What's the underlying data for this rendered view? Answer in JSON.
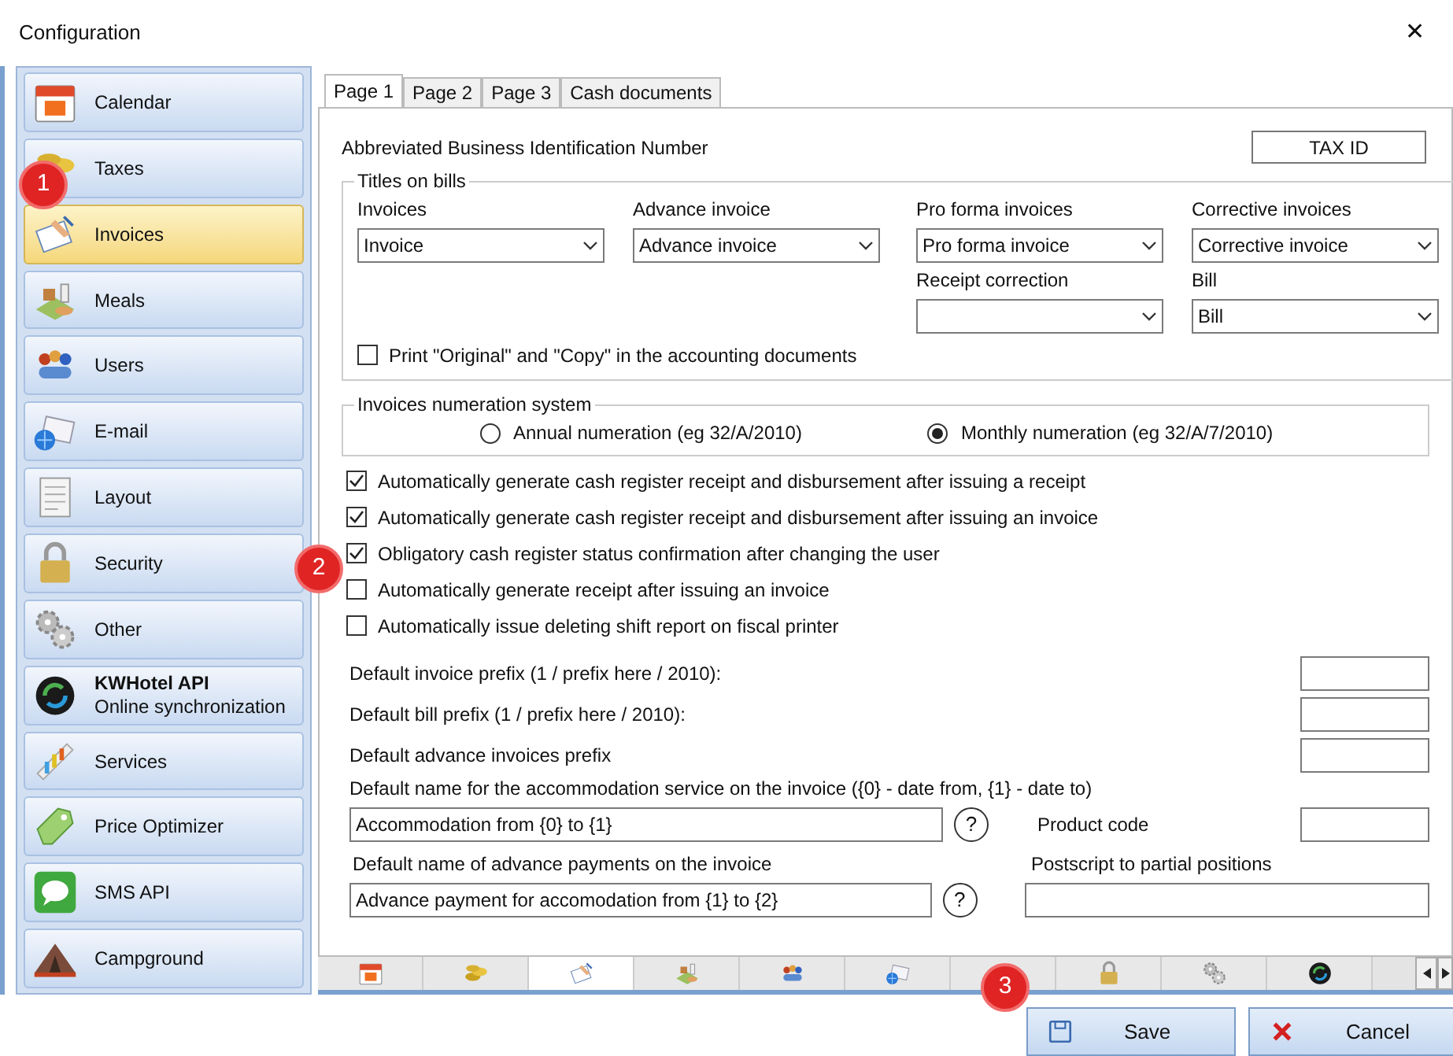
{
  "window": {
    "title": "Configuration",
    "close": "✕"
  },
  "sidebar": {
    "items": [
      {
        "label": "Calendar",
        "kind": "calendar",
        "selected": false
      },
      {
        "label": "Taxes",
        "kind": "coins",
        "selected": false
      },
      {
        "label": "Invoices",
        "kind": "invoice",
        "selected": true
      },
      {
        "label": "Meals",
        "kind": "meals",
        "selected": false
      },
      {
        "label": "Users",
        "kind": "users",
        "selected": false
      },
      {
        "label": "E-mail",
        "kind": "email",
        "selected": false
      },
      {
        "label": "Layout",
        "kind": "layout",
        "selected": false
      },
      {
        "label": "Security",
        "kind": "lock",
        "selected": false
      },
      {
        "label": "Other",
        "kind": "gears",
        "selected": false
      },
      {
        "label": "KWHotel API",
        "subtitle": "Online synchronization",
        "kind": "sync",
        "selected": false
      },
      {
        "label": "Services",
        "kind": "chart",
        "selected": false
      },
      {
        "label": "Price Optimizer",
        "kind": "tag",
        "selected": false
      },
      {
        "label": "SMS API",
        "kind": "sms",
        "selected": false
      },
      {
        "label": "Campground",
        "kind": "tent",
        "selected": false
      }
    ]
  },
  "tabs": [
    {
      "label": "Page 1",
      "selected": true
    },
    {
      "label": "Page 2",
      "selected": false
    },
    {
      "label": "Page 3",
      "selected": false
    },
    {
      "label": "Cash documents",
      "selected": false
    }
  ],
  "tax_id_row": {
    "label": "Abbreviated Business Identification Number",
    "button": "TAX ID"
  },
  "titles_on_bills": {
    "title": "Titles on bills",
    "fields": [
      {
        "label": "Invoices",
        "value": "Invoice"
      },
      {
        "label": "Advance invoice",
        "value": "Advance invoice"
      },
      {
        "label": "Pro forma invoices",
        "value": "Pro forma invoice"
      },
      {
        "label": "Corrective invoices",
        "value": "Corrective invoice"
      },
      {
        "label": "Receipt correction"
      },
      {
        "label": "Bill",
        "value": "Bill"
      }
    ],
    "print_checkbox": {
      "label": "Print \"Original\" and \"Copy\" in the accounting documents",
      "checked": false
    }
  },
  "numeration": {
    "title": "Invoices numeration system",
    "options": [
      {
        "label": "Annual numeration (eg 32/A/2010)",
        "selected": false
      },
      {
        "label": "Monthly numeration (eg 32/A/7/2010)",
        "selected": true
      }
    ]
  },
  "options": [
    {
      "label": "Automatically generate cash register receipt and disbursement after issuing a receipt",
      "checked": true
    },
    {
      "label": "Automatically generate cash register receipt and disbursement after issuing an invoice",
      "checked": true
    },
    {
      "label": "Obligatory cash register status confirmation after changing the user",
      "checked": true
    },
    {
      "label": "Automatically generate receipt after issuing an invoice",
      "checked": false
    },
    {
      "label": "Automatically issue deleting shift report on fiscal printer",
      "checked": false
    }
  ],
  "prefixes": [
    {
      "label": "Default invoice prefix (1 / prefix here / 2010):"
    },
    {
      "label": "Default bill prefix (1 /  prefix here / 2010):"
    },
    {
      "label": "Default advance invoices prefix"
    }
  ],
  "accommodation_name": {
    "label": "Default name for the accommodation service on the invoice ({0} - date from, {1} - date to)",
    "value": "Accommodation from {0} to {1}",
    "help": "?"
  },
  "product_code": {
    "label": "Product code"
  },
  "advance_name": {
    "label": "Default name of advance payments on the invoice",
    "value": "Advance payment for accomodation from {1} to {2}",
    "help": "?"
  },
  "postscript": {
    "label": "Postscript to partial positions"
  },
  "icon_tabs": [
    {
      "kind": "calendar",
      "selected": false
    },
    {
      "kind": "coins",
      "selected": false
    },
    {
      "kind": "invoice",
      "selected": true
    },
    {
      "kind": "meals",
      "selected": false
    },
    {
      "kind": "users",
      "selected": false
    },
    {
      "kind": "email",
      "selected": false
    },
    {
      "selected": false
    },
    {
      "kind": "lock",
      "selected": false
    },
    {
      "kind": "gears",
      "selected": false
    },
    {
      "kind": "sync",
      "selected": false
    }
  ],
  "buttons": [
    {
      "label": "Save",
      "kind": "save"
    },
    {
      "label": "Cancel",
      "kind": "cancel"
    }
  ],
  "annotations": [
    {
      "label": "1"
    },
    {
      "label": "2"
    },
    {
      "label": "3"
    }
  ]
}
